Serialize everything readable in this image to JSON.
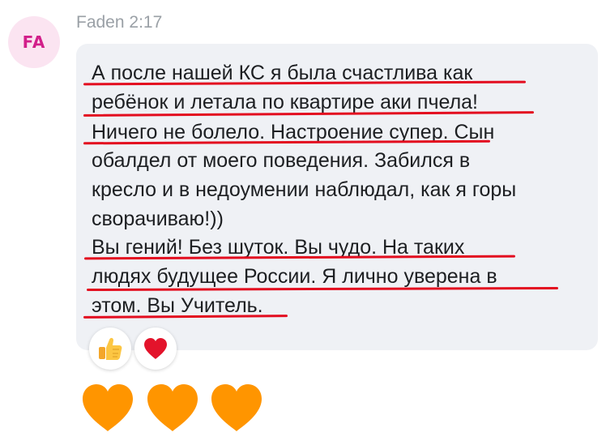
{
  "message": {
    "avatar_initials": "FA",
    "author": "Faden",
    "time": "2:17",
    "lines": [
      "А после нашей КС я была счастлива как",
      "ребёнок и летала по квартире аки пчела!",
      "Ничего не болело. Настроение супер. Сын",
      "обалдел от моего поведения. Забился в",
      "кресло и в недоумении наблюдал, как я горы",
      "сворачиваю!))",
      "Вы гений! Без шуток. Вы чудо. На таких",
      "людях будущее России. Я лично уверена в",
      "этом. Вы Учитель."
    ]
  },
  "reactions": [
    {
      "icon": "thumbs-up-icon"
    },
    {
      "icon": "heart-icon",
      "color": "#e3132b"
    }
  ],
  "emoji_row": [
    {
      "icon": "orange-heart-icon",
      "color": "#ff9500"
    },
    {
      "icon": "orange-heart-icon",
      "color": "#ff9500"
    },
    {
      "icon": "orange-heart-icon",
      "color": "#ff9500"
    }
  ],
  "colors": {
    "underline": "#e30d1f",
    "bubble": "#eff1f5",
    "avatar_bg": "#fbe4f1",
    "avatar_text": "#d21f8a"
  }
}
